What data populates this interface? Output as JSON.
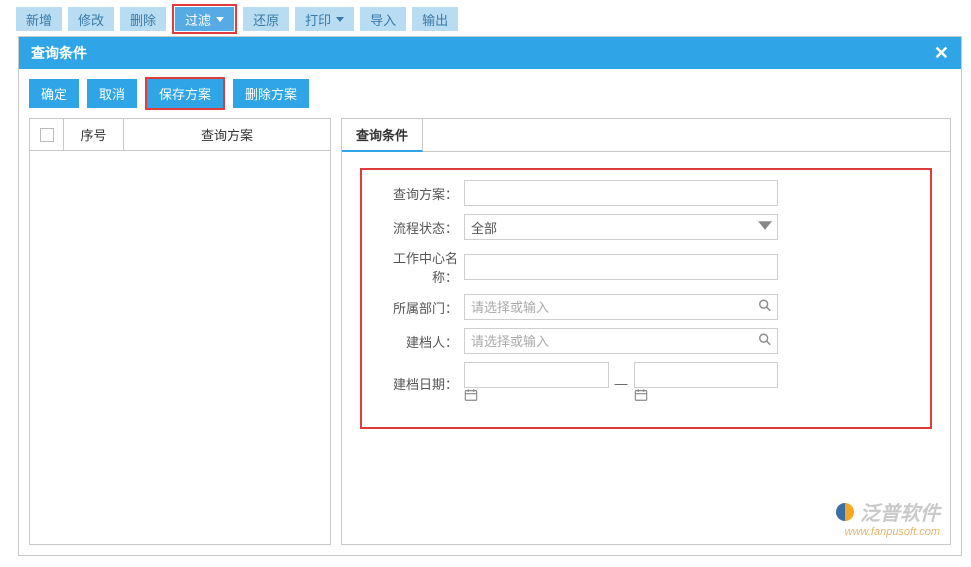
{
  "toolbar": {
    "new": "新增",
    "edit": "修改",
    "delete": "删除",
    "filter": "过滤",
    "restore": "还原",
    "print": "打印",
    "import": "导入",
    "export": "输出"
  },
  "dialog": {
    "title": "查询条件",
    "buttons": {
      "ok": "确定",
      "cancel": "取消",
      "save_scheme": "保存方案",
      "delete_scheme": "删除方案"
    },
    "left": {
      "col_seq": "序号",
      "col_scheme": "查询方案"
    },
    "right": {
      "tab": "查询条件",
      "fields": {
        "scheme_label": "查询方案：",
        "scheme_value": "",
        "status_label": "流程状态：",
        "status_value": "全部",
        "center_label": "工作中心名称：",
        "center_value": "",
        "dept_label": "所属部门：",
        "dept_placeholder": "请选择或输入",
        "creator_label": "建档人：",
        "creator_placeholder": "请选择或输入",
        "date_label": "建档日期：",
        "date_from": "",
        "date_to": ""
      }
    }
  },
  "watermark": {
    "brand": "泛普软件",
    "url": "www.fanpusoft.com"
  }
}
